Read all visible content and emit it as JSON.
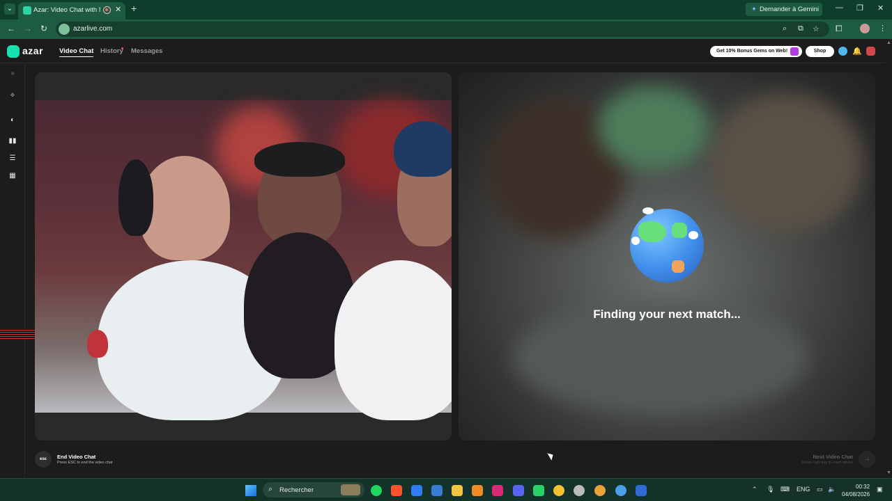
{
  "browser": {
    "tab_title": "Azar: Video Chat with New",
    "new_tab": "+",
    "gemini_label": "Demander à Gemini",
    "url": "azarlive.com"
  },
  "app": {
    "logo": "azar",
    "nav": [
      "Video Chat",
      "History",
      "Messages"
    ],
    "promo_label": "Get 10% Bonus Gems on Web!",
    "shop_label": "Shop"
  },
  "match": {
    "status_text": "Finding your next match..."
  },
  "controls": {
    "esc_label": "esc",
    "end_title": "End Video Chat",
    "end_sub": "Press ESC to end the video chat",
    "next_title": "Next Video Chat",
    "next_sub": "Press right key to meet others"
  },
  "taskbar": {
    "search_placeholder": "Rechercher",
    "lang": "ENG",
    "time": "00:32",
    "date": "04/08/2026"
  },
  "colors": {
    "accent": "#19e0b0",
    "browser_frame": "#1d5c42",
    "page_bg": "#1c1c1c"
  }
}
